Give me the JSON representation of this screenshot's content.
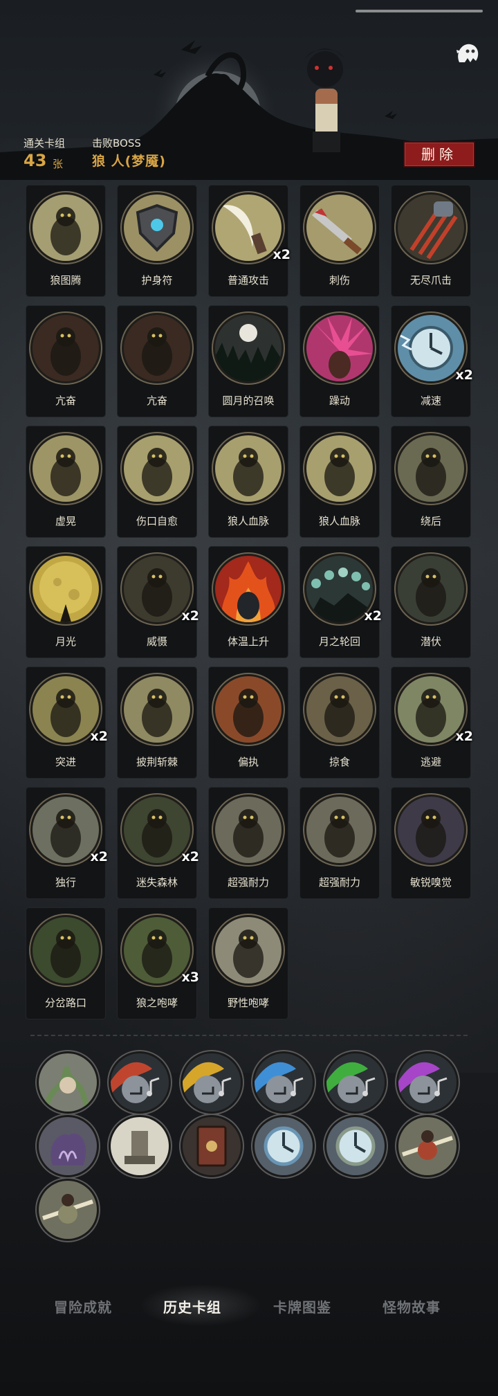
{
  "header": {
    "cleared_deck_label": "通关卡组",
    "card_count": "43",
    "card_unit": "张",
    "defeated_boss_label": "击败BOSS",
    "boss_name": "狼 人(梦魇)",
    "delete_label": "删除"
  },
  "cards": [
    {
      "name": "狼图腾",
      "mult": "",
      "art": "wolf",
      "tone": "#a59e72"
    },
    {
      "name": "护身符",
      "mult": "",
      "art": "shield",
      "tone": "#9b9165"
    },
    {
      "name": "普通攻击",
      "mult": "x2",
      "art": "slash",
      "tone": "#b0a674"
    },
    {
      "name": "刺伤",
      "mult": "",
      "art": "sword",
      "tone": "#a59b6c"
    },
    {
      "name": "无尽爪击",
      "mult": "",
      "art": "claw",
      "tone": "#3e3a30"
    },
    {
      "name": "亢奋",
      "mult": "",
      "art": "beast",
      "tone": "#3a2a22"
    },
    {
      "name": "亢奋",
      "mult": "",
      "art": "beast",
      "tone": "#3a2a22"
    },
    {
      "name": "圆月的召唤",
      "mult": "",
      "art": "moon",
      "tone": "#2d3230"
    },
    {
      "name": "躁动",
      "mult": "",
      "art": "burst",
      "tone": "#b0376e"
    },
    {
      "name": "减速",
      "mult": "x2",
      "art": "clock",
      "tone": "#5f8ea8"
    },
    {
      "name": "虚晃",
      "mult": "",
      "art": "fist",
      "tone": "#9e9566"
    },
    {
      "name": "伤口自愈",
      "mult": "",
      "art": "boy",
      "tone": "#a79f6d"
    },
    {
      "name": "狼人血脉",
      "mult": "",
      "art": "arm",
      "tone": "#a89f6f"
    },
    {
      "name": "狼人血脉",
      "mult": "",
      "art": "arm",
      "tone": "#a89f6f"
    },
    {
      "name": "绕后",
      "mult": "",
      "art": "skull",
      "tone": "#6a6a52"
    },
    {
      "name": "月光",
      "mult": "",
      "art": "fullmoon",
      "tone": "#c2a844"
    },
    {
      "name": "威慑",
      "mult": "x2",
      "art": "bear",
      "tone": "#3d3a2e"
    },
    {
      "name": "体温上升",
      "mult": "",
      "art": "fire",
      "tone": "#a2291b"
    },
    {
      "name": "月之轮回",
      "mult": "x2",
      "art": "phases",
      "tone": "#2c3836"
    },
    {
      "name": "潜伏",
      "mult": "",
      "art": "lurk",
      "tone": "#3a3f35"
    },
    {
      "name": "突进",
      "mult": "x2",
      "art": "dash",
      "tone": "#8b8450"
    },
    {
      "name": "披荆斩棘",
      "mult": "",
      "art": "thorn",
      "tone": "#8f8a62"
    },
    {
      "name": "偏执",
      "mult": "",
      "art": "rage",
      "tone": "#8a4a2a"
    },
    {
      "name": "掠食",
      "mult": "",
      "art": "hunt",
      "tone": "#6b6148"
    },
    {
      "name": "逃避",
      "mult": "x2",
      "art": "run",
      "tone": "#7f8664"
    },
    {
      "name": "独行",
      "mult": "x2",
      "art": "lone",
      "tone": "#6d7060"
    },
    {
      "name": "迷失森林",
      "mult": "x2",
      "art": "forest",
      "tone": "#3e4530"
    },
    {
      "name": "超强耐力",
      "mult": "",
      "art": "cave",
      "tone": "#6c6a5a"
    },
    {
      "name": "超强耐力",
      "mult": "",
      "art": "cave",
      "tone": "#6c6a5a"
    },
    {
      "name": "敏锐嗅觉",
      "mult": "",
      "art": "snarl",
      "tone": "#3e3a48"
    },
    {
      "name": "分岔路口",
      "mult": "",
      "art": "cross",
      "tone": "#3c4a2e"
    },
    {
      "name": "狼之咆哮",
      "mult": "x3",
      "art": "howl",
      "tone": "#4e5c38"
    },
    {
      "name": "野性咆哮",
      "mult": "",
      "art": "howlmoon",
      "tone": "#8d8b78"
    }
  ],
  "relics": [
    {
      "art": "tentacle",
      "color": "#6a8a55"
    },
    {
      "art": "note",
      "color": "#c0452e"
    },
    {
      "art": "note",
      "color": "#d6a62a"
    },
    {
      "art": "note",
      "color": "#3f8fd6"
    },
    {
      "art": "note",
      "color": "#3fae3f"
    },
    {
      "art": "note",
      "color": "#a645c8"
    },
    {
      "art": "blob",
      "color": "#5e4a7a"
    },
    {
      "art": "ruin",
      "color": "#7a7566"
    },
    {
      "art": "book",
      "color": "#7a3b2c"
    },
    {
      "art": "clock",
      "color": "#6a95b4"
    },
    {
      "art": "clock",
      "color": "#8a9a8a"
    },
    {
      "art": "warrior",
      "color": "#a9452f"
    },
    {
      "art": "swordsman",
      "color": "#8a8a6a"
    }
  ],
  "nav": [
    {
      "label": "冒险成就"
    },
    {
      "label": "历史卡组"
    },
    {
      "label": "卡牌图鉴"
    },
    {
      "label": "怪物故事"
    }
  ]
}
